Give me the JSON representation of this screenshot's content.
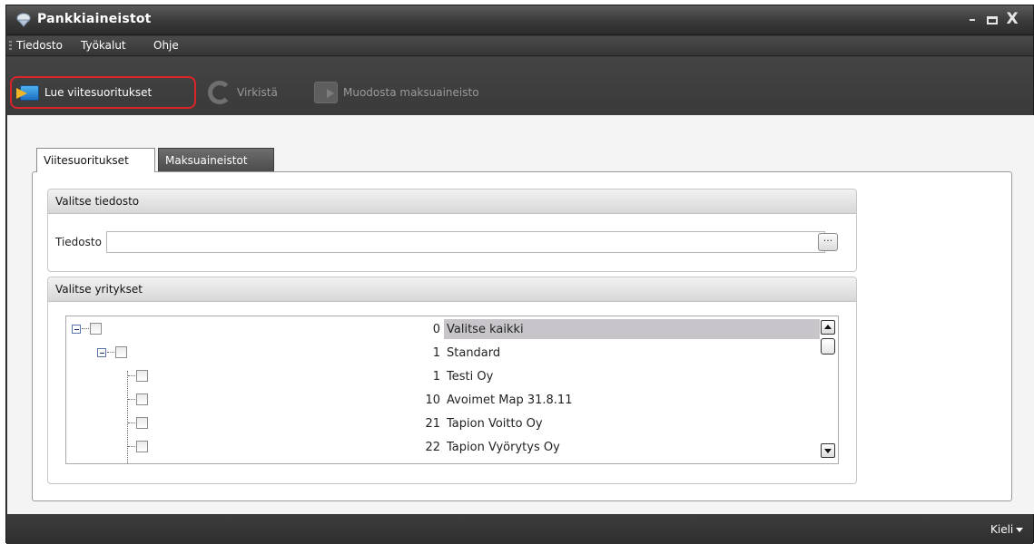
{
  "window": {
    "title": "Pankkiaineistot",
    "controls": {
      "minimize": "–",
      "close": "X"
    }
  },
  "menu": {
    "items": [
      "Tiedosto",
      "Työkalut",
      "Ohje"
    ]
  },
  "toolbar": {
    "read_label": "Lue viitesuoritukset",
    "refresh_label": "Virkistä",
    "payment_label": "Muodosta maksuaineisto"
  },
  "tabs": [
    {
      "label": "Viitesuoritukset",
      "active": true
    },
    {
      "label": "Maksuaineistot",
      "active": false
    }
  ],
  "file_group": {
    "title": "Valitse tiedosto",
    "field_label": "Tiedosto",
    "value": "",
    "browse_label": "···"
  },
  "company_group": {
    "title": "Valitse yritykset",
    "rows": [
      {
        "number": "0",
        "name": "Valitse kaikki",
        "level": 0,
        "selected": true
      },
      {
        "number": "1",
        "name": "Standard",
        "level": 1,
        "selected": false
      },
      {
        "number": "1",
        "name": "Testi Oy",
        "level": 2,
        "selected": false
      },
      {
        "number": "10",
        "name": "Avoimet Map 31.8.11",
        "level": 2,
        "selected": false
      },
      {
        "number": "21",
        "name": "Tapion Voitto Oy",
        "level": 2,
        "selected": false
      },
      {
        "number": "22",
        "name": "Tapion Vyörytys Oy",
        "level": 2,
        "selected": false
      }
    ]
  },
  "status": {
    "language_label": "Kieli"
  },
  "colors": {
    "highlight_border": "#d9242a",
    "selected_row": "#c7c5c9",
    "chrome_dark": "#3c3c3c"
  }
}
